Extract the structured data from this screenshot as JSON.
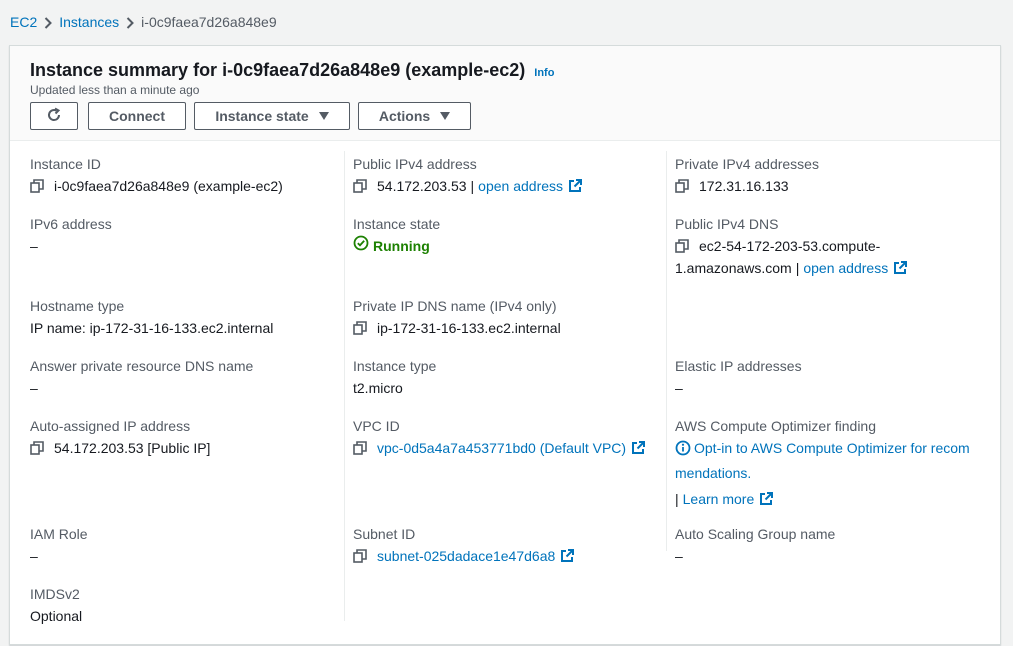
{
  "breadcrumb": {
    "items": [
      "EC2",
      "Instances"
    ],
    "current": "i-0c9faea7d26a848e9"
  },
  "header": {
    "title": "Instance summary for i-0c9faea7d26a848e9 (example-ec2)",
    "info": "Info",
    "updated": "Updated less than a minute ago",
    "buttons": {
      "connect": "Connect",
      "instance_state": "Instance state",
      "actions": "Actions"
    }
  },
  "fields": {
    "instance_id": {
      "label": "Instance ID",
      "value": "i-0c9faea7d26a848e9 (example-ec2)"
    },
    "public_ipv4": {
      "label": "Public IPv4 address",
      "value": "54.172.203.53",
      "link": "open address"
    },
    "private_ipv4": {
      "label": "Private IPv4 addresses",
      "value": "172.31.16.133"
    },
    "ipv6": {
      "label": "IPv6 address",
      "value": "–"
    },
    "instance_state": {
      "label": "Instance state",
      "value": "Running",
      "color": "#1d8102"
    },
    "public_dns": {
      "label": "Public IPv4 DNS",
      "value_line1": "ec2-54-172-203-53.compute-",
      "value_line2": "1.amazonaws.com",
      "link": "open address"
    },
    "hostname_type": {
      "label": "Hostname type",
      "value": "IP name: ip-172-31-16-133.ec2.internal"
    },
    "private_dns": {
      "label": "Private IP DNS name (IPv4 only)",
      "value": "ip-172-31-16-133.ec2.internal"
    },
    "answer_dns": {
      "label": "Answer private resource DNS name",
      "value": "–"
    },
    "instance_type": {
      "label": "Instance type",
      "value": "t2.micro"
    },
    "elastic_ip": {
      "label": "Elastic IP addresses",
      "value": "–"
    },
    "auto_ip": {
      "label": "Auto-assigned IP address",
      "value": "54.172.203.53 [Public IP]"
    },
    "vpc_id": {
      "label": "VPC ID",
      "value": "vpc-0d5a4a7a453771bd0 (Default VPC)"
    },
    "optimizer": {
      "label": "AWS Compute Optimizer finding",
      "line1": "Opt-in to AWS Compute Optimizer for recom",
      "line2": "mendations.",
      "learn_more": "Learn more"
    },
    "iam_role": {
      "label": "IAM Role",
      "value": "–"
    },
    "subnet_id": {
      "label": "Subnet ID",
      "value": "subnet-025dadace1e47d6a8"
    },
    "asg_name": {
      "label": "Auto Scaling Group name",
      "value": "–"
    },
    "imdsv2": {
      "label": "IMDSv2",
      "value": "Optional"
    }
  },
  "colors": {
    "link": "#0073bb",
    "success": "#1d8102",
    "text": "#16191f",
    "muted": "#545b64"
  }
}
